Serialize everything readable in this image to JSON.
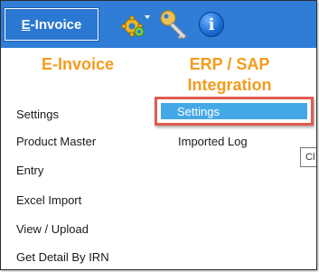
{
  "toolbar": {
    "einvoice_prefix": "E",
    "einvoice_rest": "-Invoice",
    "icons": [
      "settings-gear-icon",
      "key-icon",
      "info-icon"
    ],
    "info_glyph": "i"
  },
  "einvoice_column": {
    "title": "E-Invoice",
    "items": [
      "Settings",
      "Product Master",
      "Entry",
      "Excel Import",
      "View / Upload",
      "Get Detail By IRN"
    ]
  },
  "erp_column": {
    "title_line1": "ERP / SAP",
    "title_line2": "Integration",
    "items": [
      "Settings",
      "Imported Log"
    ]
  },
  "tooltip": {
    "text": "Cl"
  },
  "colors": {
    "toolbar_bg": "#2f7dd6",
    "title_orange": "#f39b1d",
    "selected_bg": "#45a8e6",
    "highlight_border": "#e05a4f"
  }
}
